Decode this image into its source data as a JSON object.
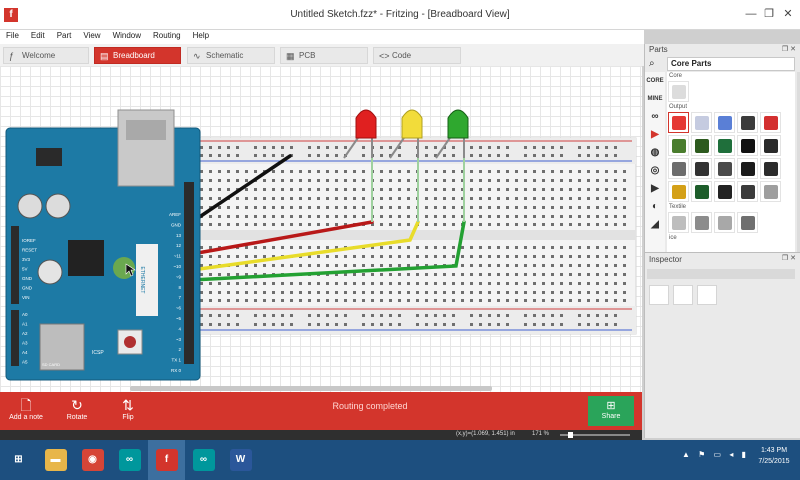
{
  "window": {
    "title": "Untitled Sketch.fzz* - Fritzing - [Breadboard View]",
    "app_icon_letter": "f",
    "minimize_glyph": "—",
    "restore_glyph": "❐",
    "close_glyph": "✕"
  },
  "menubar": [
    "File",
    "Edit",
    "Part",
    "View",
    "Window",
    "Routing",
    "Help"
  ],
  "tabs": [
    {
      "label": "Welcome",
      "icon": "fritzing-icon"
    },
    {
      "label": "Breadboard",
      "icon": "breadboard-icon",
      "active": true
    },
    {
      "label": "Schematic",
      "icon": "schematic-icon"
    },
    {
      "label": "PCB",
      "icon": "pcb-icon"
    },
    {
      "label": "Code",
      "icon": "code-icon"
    }
  ],
  "tab_icons": [
    "ƒ",
    "▤",
    "∿",
    "▦",
    "<>"
  ],
  "arduino": {
    "pin_labels": [
      "AREF",
      "GND",
      "13",
      "12",
      "~11",
      "~10",
      "~9",
      "8",
      "7",
      "~6",
      "~5",
      "4",
      "~3",
      "2",
      "TX 1",
      "RX 0"
    ],
    "power_labels": [
      "IOREF",
      "RESET",
      "3V3",
      "5V",
      "GND",
      "GND",
      "VIN"
    ],
    "analog_labels": [
      "A0",
      "A1",
      "A2",
      "A3",
      "A4",
      "A5"
    ],
    "board_text": [
      "ARDUINO",
      "ETHERNET",
      "ICSP",
      "SD CARD"
    ]
  },
  "leds": [
    {
      "color_name": "red",
      "color": "#e02020"
    },
    {
      "color_name": "yellow",
      "color": "#f2dc3a"
    },
    {
      "color_name": "green",
      "color": "#2fa82f"
    }
  ],
  "wires": [
    {
      "color": "#111111"
    },
    {
      "color": "#b81818"
    },
    {
      "color": "#e8dc2a"
    },
    {
      "color": "#23a132"
    }
  ],
  "toolbar": {
    "add_note_label": "Add a note",
    "rotate_label": "Rotate",
    "flip_label": "Flip",
    "routing_status": "Routing completed",
    "share_label": "Share"
  },
  "status": {
    "coords": "(x,y)=(1.069, 1.451) in",
    "zoom": "171 %"
  },
  "parts_panel": {
    "title": "Parts",
    "bin_title": "Core Parts",
    "bin_tabs": [
      "CORE",
      "MINE"
    ],
    "section_core_label": "Core",
    "section_output_label": "Output",
    "section_textile_label": "Textile",
    "section_ice_label": "ice",
    "output_parts": [
      {
        "name": "red-led",
        "color": "#e53935"
      },
      {
        "name": "light-bulb",
        "color": "#c5cbe0"
      },
      {
        "name": "rgb-led",
        "color": "#5a7fd6"
      },
      {
        "name": "led-matrix",
        "color": "#3b3b3b"
      },
      {
        "name": "seven-segment",
        "color": "#d32f2f"
      },
      {
        "name": "lcd",
        "color": "#4a7d2e"
      },
      {
        "name": "oled",
        "color": "#2d5a1e"
      },
      {
        "name": "display-module",
        "color": "#1f6f3b"
      },
      {
        "name": "speaker",
        "color": "#111111"
      },
      {
        "name": "piezo",
        "color": "#2a2a2a"
      },
      {
        "name": "vibration-motor",
        "color": "#6d6d6d"
      },
      {
        "name": "servo",
        "color": "#333333"
      },
      {
        "name": "stepper",
        "color": "#4a4a4a"
      },
      {
        "name": "motor-driver",
        "color": "#1a1a1a"
      },
      {
        "name": "relay",
        "color": "#2b2b2b"
      },
      {
        "name": "battery",
        "color": "#d4a017"
      },
      {
        "name": "shield",
        "color": "#1d5d2a"
      },
      {
        "name": "chip",
        "color": "#222222"
      },
      {
        "name": "module",
        "color": "#3a3a3a"
      },
      {
        "name": "cable",
        "color": "#9e9e9e"
      }
    ],
    "textile_parts": [
      {
        "name": "conductive-thread",
        "color": "#bdbdbd"
      },
      {
        "name": "stitch",
        "color": "#8c8c8c"
      },
      {
        "name": "textile-sensor",
        "color": "#a8a8a8"
      },
      {
        "name": "textile-cable",
        "color": "#6f6f6f"
      }
    ]
  },
  "inspector": {
    "title": "Inspector"
  },
  "taskbar": {
    "apps": [
      {
        "name": "start",
        "glyph": "⊞",
        "color": "#1d4f7f"
      },
      {
        "name": "file-explorer",
        "glyph": "▬",
        "color": "#e8b64a"
      },
      {
        "name": "chrome",
        "glyph": "◉",
        "color": "#d64537"
      },
      {
        "name": "arduino",
        "glyph": "∞",
        "color": "#00979c"
      },
      {
        "name": "fritzing",
        "glyph": "f",
        "color": "#d3352c"
      },
      {
        "name": "arduino-2",
        "glyph": "∞",
        "color": "#00979c"
      },
      {
        "name": "word",
        "glyph": "W",
        "color": "#2b579a"
      }
    ],
    "tray_icons": "▲ ⚑ ▭ ◂ ▮",
    "time": "1:43 PM",
    "date": "7/25/2015"
  }
}
